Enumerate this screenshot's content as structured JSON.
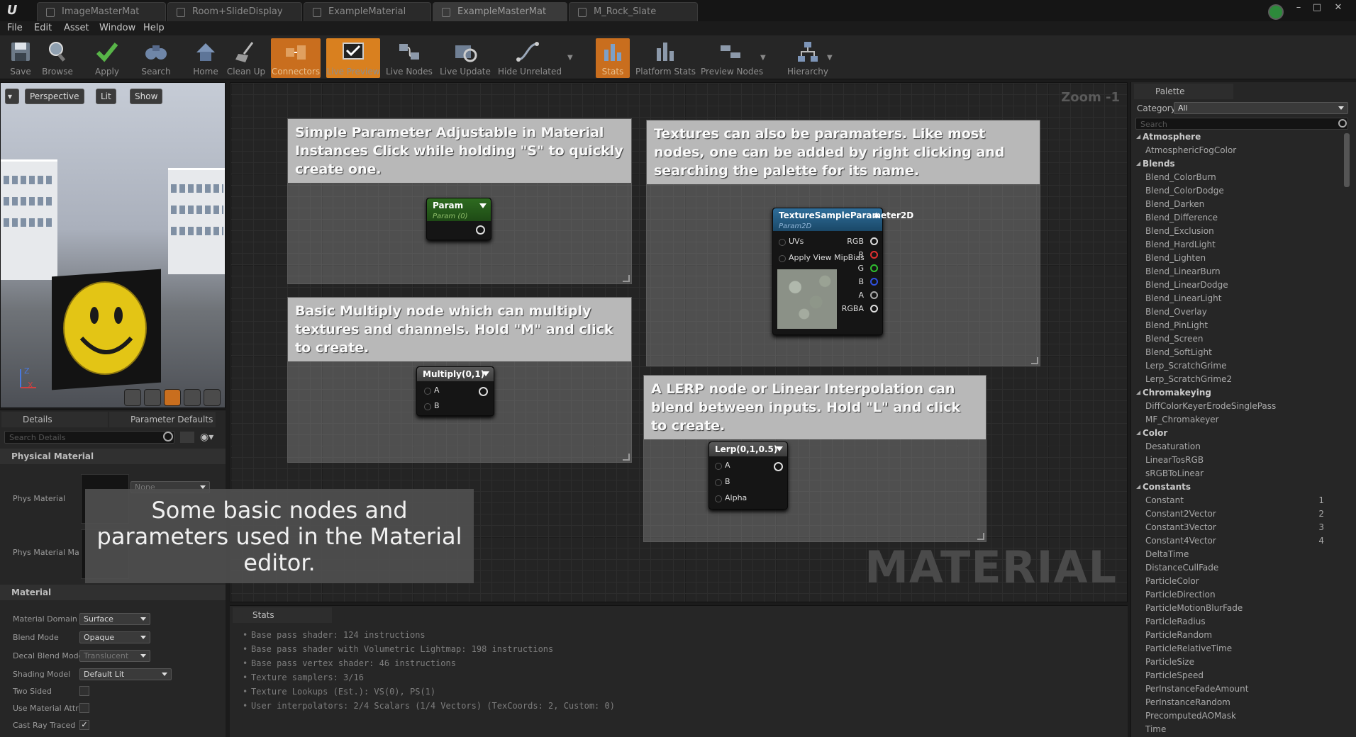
{
  "tabs": [
    {
      "label": "ImageMasterMat"
    },
    {
      "label": "Room+SlideDisplay"
    },
    {
      "label": "ExampleMaterial"
    },
    {
      "label": "ExampleMasterMat"
    },
    {
      "label": "M_Rock_Slate"
    }
  ],
  "menu": [
    "File",
    "Edit",
    "Asset",
    "Window",
    "Help"
  ],
  "toolbar": [
    "Save",
    "Browse",
    "Apply",
    "Search",
    "Home",
    "Clean Up",
    "Connectors",
    "Live Preview",
    "Live Nodes",
    "Live Update",
    "Hide Unrelated",
    "Stats",
    "Platform Stats",
    "Preview Nodes",
    "Hierarchy"
  ],
  "viewport": {
    "perspective": "Perspective",
    "lit": "Lit",
    "show": "Show",
    "axis_z": "Z",
    "axis_x": "X"
  },
  "details": {
    "tab_details": "Details",
    "tab_params": "Parameter Defaults",
    "search_placeholder": "Search Details",
    "cat_physical": "Physical Material",
    "phys_material": "Phys Material",
    "phys_material_map": "Phys Material Ma",
    "phys_value": "None",
    "cat_material": "Material",
    "rows": [
      {
        "label": "Material Domain",
        "value": "Surface"
      },
      {
        "label": "Blend Mode",
        "value": "Opaque"
      },
      {
        "label": "Decal Blend Mode",
        "value": "Translucent"
      },
      {
        "label": "Shading Model",
        "value": "Default Lit"
      }
    ],
    "checks": [
      {
        "label": "Two Sided",
        "checked": false
      },
      {
        "label": "Use Material Attri",
        "checked": false
      },
      {
        "label": "Cast Ray Traced",
        "checked": true
      }
    ]
  },
  "caption": "Some basic nodes and parameters used in the Material editor.",
  "graph": {
    "zoom": "Zoom -1",
    "watermark": "MATERIAL",
    "comments": [
      "Simple Parameter Adjustable in Material Instances Click while holding \"S\" to quickly create one.",
      "Basic Multiply node which can multiply textures and channels. Hold \"M\" and click to create.",
      "Textures can also be paramaters. Like most nodes, one can be added by right clicking and searching the palette for its name.",
      "A LERP node or Linear Interpolation can blend between inputs. Hold \"L\" and click to create."
    ],
    "param_node": {
      "title": "Param",
      "subtitle": "Param (0)"
    },
    "multiply_node": {
      "title": "Multiply(0,1)",
      "a": "A",
      "b": "B"
    },
    "texture_node": {
      "title": "TextureSampleParameter2D",
      "subtitle": "Param2D",
      "in_uvs": "UVs",
      "in_mip": "Apply View MipBias",
      "outs": [
        "RGB",
        "R",
        "G",
        "B",
        "A",
        "RGBA"
      ],
      "out_colors": [
        "#dddddd",
        "#e03030",
        "#30c030",
        "#3050e0",
        "#aaaaaa",
        "#dddddd"
      ]
    },
    "lerp_node": {
      "title": "Lerp(0,1,0.5)",
      "a": "A",
      "b": "B",
      "alpha": "Alpha"
    }
  },
  "stats": {
    "tab": "Stats",
    "lines": [
      "Base pass shader: 124 instructions",
      "Base pass shader with Volumetric Lightmap: 198 instructions",
      "Base pass vertex shader: 46 instructions",
      "Texture samplers: 3/16",
      "Texture Lookups (Est.): VS(0), PS(1)",
      "User interpolators: 2/4 Scalars (1/4 Vectors) (TexCoords: 2, Custom: 0)"
    ]
  },
  "palette": {
    "tab": "Palette",
    "category_label": "Category:",
    "category_value": "All",
    "search_placeholder": "Search",
    "entries": [
      {
        "t": "cat",
        "label": "Atmosphere"
      },
      {
        "t": "item",
        "label": "AtmosphericFogColor"
      },
      {
        "t": "cat",
        "label": "Blends"
      },
      {
        "t": "item",
        "label": "Blend_ColorBurn"
      },
      {
        "t": "item",
        "label": "Blend_ColorDodge"
      },
      {
        "t": "item",
        "label": "Blend_Darken"
      },
      {
        "t": "item",
        "label": "Blend_Difference"
      },
      {
        "t": "item",
        "label": "Blend_Exclusion"
      },
      {
        "t": "item",
        "label": "Blend_HardLight"
      },
      {
        "t": "item",
        "label": "Blend_Lighten"
      },
      {
        "t": "item",
        "label": "Blend_LinearBurn"
      },
      {
        "t": "item",
        "label": "Blend_LinearDodge"
      },
      {
        "t": "item",
        "label": "Blend_LinearLight"
      },
      {
        "t": "item",
        "label": "Blend_Overlay"
      },
      {
        "t": "item",
        "label": "Blend_PinLight"
      },
      {
        "t": "item",
        "label": "Blend_Screen"
      },
      {
        "t": "item",
        "label": "Blend_SoftLight"
      },
      {
        "t": "item",
        "label": "Lerp_ScratchGrime"
      },
      {
        "t": "item",
        "label": "Lerp_ScratchGrime2"
      },
      {
        "t": "cat",
        "label": "Chromakeying"
      },
      {
        "t": "item",
        "label": "DiffColorKeyerErodeSinglePass"
      },
      {
        "t": "item",
        "label": "MF_Chromakeyer"
      },
      {
        "t": "cat",
        "label": "Color"
      },
      {
        "t": "item",
        "label": "Desaturation"
      },
      {
        "t": "item",
        "label": "LinearTosRGB"
      },
      {
        "t": "item",
        "label": "sRGBToLinear"
      },
      {
        "t": "cat",
        "label": "Constants"
      },
      {
        "t": "item",
        "label": "Constant",
        "num": "1"
      },
      {
        "t": "item",
        "label": "Constant2Vector",
        "num": "2"
      },
      {
        "t": "item",
        "label": "Constant3Vector",
        "num": "3"
      },
      {
        "t": "item",
        "label": "Constant4Vector",
        "num": "4"
      },
      {
        "t": "item",
        "label": "DeltaTime"
      },
      {
        "t": "item",
        "label": "DistanceCullFade"
      },
      {
        "t": "item",
        "label": "ParticleColor"
      },
      {
        "t": "item",
        "label": "ParticleDirection"
      },
      {
        "t": "item",
        "label": "ParticleMotionBlurFade"
      },
      {
        "t": "item",
        "label": "ParticleRadius"
      },
      {
        "t": "item",
        "label": "ParticleRandom"
      },
      {
        "t": "item",
        "label": "ParticleRelativeTime"
      },
      {
        "t": "item",
        "label": "ParticleSize"
      },
      {
        "t": "item",
        "label": "ParticleSpeed"
      },
      {
        "t": "item",
        "label": "PerInstanceFadeAmount"
      },
      {
        "t": "item",
        "label": "PerInstanceRandom"
      },
      {
        "t": "item",
        "label": "PrecomputedAOMask"
      },
      {
        "t": "item",
        "label": "Time"
      }
    ]
  }
}
